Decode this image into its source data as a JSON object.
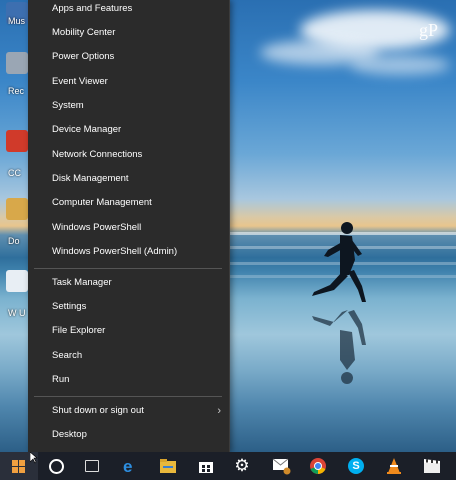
{
  "watermark": "gP",
  "menu": {
    "group1": [
      {
        "label": "Apps and Features"
      },
      {
        "label": "Mobility Center"
      },
      {
        "label": "Power Options"
      },
      {
        "label": "Event Viewer"
      },
      {
        "label": "System"
      },
      {
        "label": "Device Manager"
      },
      {
        "label": "Network Connections"
      },
      {
        "label": "Disk Management"
      },
      {
        "label": "Computer Management"
      },
      {
        "label": "Windows PowerShell"
      },
      {
        "label": "Windows PowerShell (Admin)"
      }
    ],
    "group2": [
      {
        "label": "Task Manager"
      },
      {
        "label": "Settings"
      },
      {
        "label": "File Explorer"
      },
      {
        "label": "Search"
      },
      {
        "label": "Run"
      }
    ],
    "group3": [
      {
        "label": "Shut down or sign out",
        "submenu": true
      },
      {
        "label": "Desktop"
      }
    ]
  },
  "desktop_labels": [
    "Mus",
    "Rec",
    "CC",
    "Do",
    "W U"
  ],
  "taskbar": {
    "icons": [
      "windows-start-icon",
      "cortana-icon",
      "task-view-icon",
      "edge-icon",
      "file-explorer-icon",
      "store-icon",
      "settings-icon",
      "mail-icon",
      "chrome-icon",
      "skype-icon",
      "vlc-icon",
      "movie-maker-icon"
    ]
  }
}
